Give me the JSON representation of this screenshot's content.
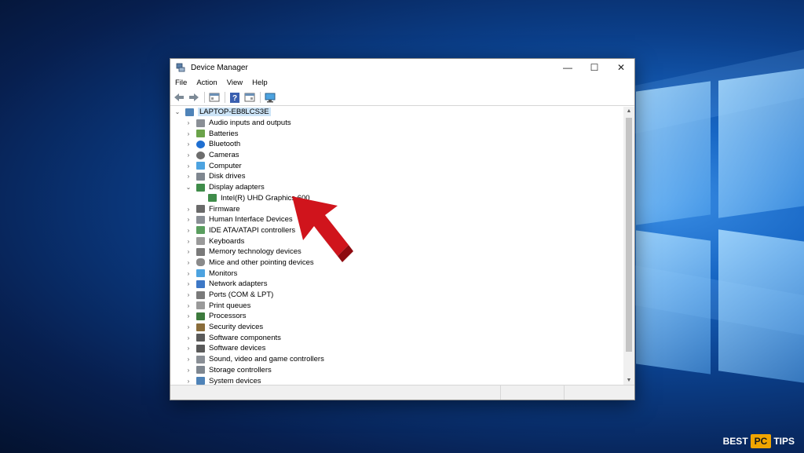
{
  "window": {
    "title": "Device Manager",
    "controls": {
      "minimize": "—",
      "maximize": "☐",
      "close": "✕"
    }
  },
  "menu": [
    "File",
    "Action",
    "View",
    "Help"
  ],
  "toolbar_icons": [
    "back-icon",
    "forward-icon",
    "properties-icon",
    "help-icon",
    "show-hidden-icon",
    "scan-hardware-icon"
  ],
  "tree": {
    "root": "LAPTOP-EB8LCS3E",
    "categories": [
      "Audio inputs and outputs",
      "Batteries",
      "Bluetooth",
      "Cameras",
      "Computer",
      "Disk drives",
      "Display adapters",
      "Intel(R) UHD Graphics 600",
      "Firmware",
      "Human Interface Devices",
      "IDE ATA/ATAPI controllers",
      "Keyboards",
      "Memory technology devices",
      "Mice and other pointing devices",
      "Monitors",
      "Network adapters",
      "Ports (COM & LPT)",
      "Print queues",
      "Processors",
      "Security devices",
      "Software components",
      "Software devices",
      "Sound, video and game controllers",
      "Storage controllers",
      "System devices"
    ]
  },
  "brand": {
    "left": "BEST",
    "mid": "PC",
    "right": "TIPS"
  },
  "colors": {
    "selection": "#cce4f7",
    "arrow": "#d0141c",
    "brand_accent": "#f0a500"
  }
}
